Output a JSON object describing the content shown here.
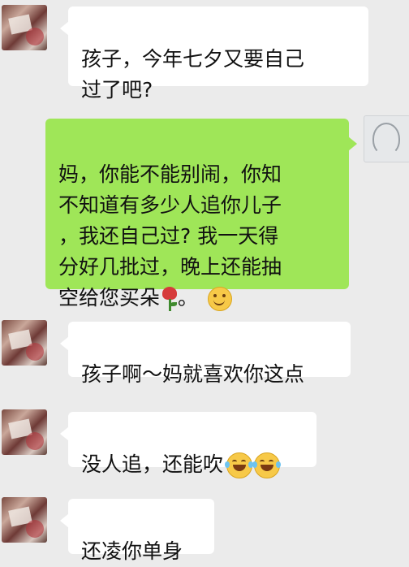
{
  "messages": [
    {
      "side": "left",
      "text": "孩子，今年七夕又要自己\n过了吧?"
    },
    {
      "side": "right",
      "text": "妈，你能不能别闹，你知\n不知道有多少人追你儿子\n，我还自己过? 我一天得\n分好几批过，晚上还能抽\n空给您买朵",
      "after_rose": "。",
      "emojis": [
        "rose-emoji",
        "smile-emoji"
      ]
    },
    {
      "side": "left",
      "text": "孩子啊～妈就喜欢你这点"
    },
    {
      "side": "left",
      "text": "没人追，还能吹",
      "emojis": [
        "laughing-tears-emoji",
        "laughing-tears-emoji"
      ]
    },
    {
      "side": "left",
      "text": "还凌你单身"
    }
  ]
}
